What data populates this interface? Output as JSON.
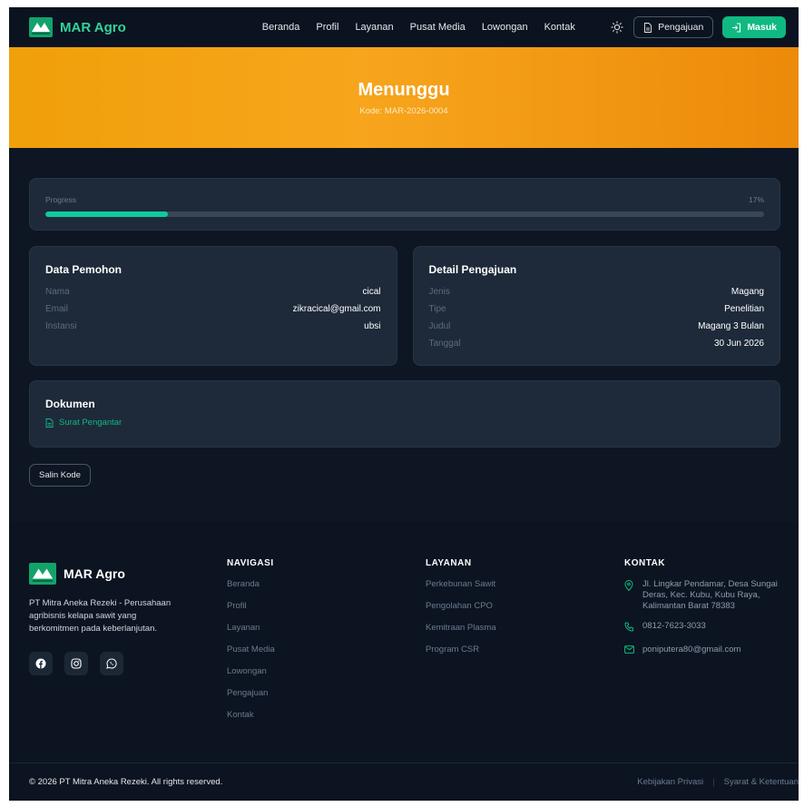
{
  "header": {
    "brand": "MAR Agro",
    "nav": [
      "Beranda",
      "Profil",
      "Layanan",
      "Pusat Media",
      "Lowongan",
      "Kontak"
    ],
    "submit_label": "Pengajuan",
    "login_label": "Masuk"
  },
  "hero": {
    "status": "Menunggu",
    "code": "Kode: MAR-2026-0004"
  },
  "progress": {
    "label": "Progress",
    "percent_text": "17%",
    "value": 0.17
  },
  "applicant": {
    "title": "Data Pemohon",
    "rows": [
      {
        "key": "Nama",
        "value": "cical"
      },
      {
        "key": "Email",
        "value": "zikracical@gmail.com"
      },
      {
        "key": "Instansi",
        "value": "ubsi"
      }
    ]
  },
  "submission": {
    "title": "Detail Pengajuan",
    "rows": [
      {
        "key": "Jenis",
        "value": "Magang"
      },
      {
        "key": "Tipe",
        "value": "Penelitian"
      },
      {
        "key": "Judul",
        "value": "Magang 3 Bulan"
      },
      {
        "key": "Tanggal",
        "value": "30 Jun 2026"
      }
    ]
  },
  "documents": {
    "title": "Dokumen",
    "items": [
      "Surat Pengantar"
    ]
  },
  "copy_label": "Salin Kode",
  "footer": {
    "brand": "MAR Agro",
    "description": "PT Mitra Aneka Rezeki - Perusahaan agribisnis kelapa sawit yang berkomitmen pada keberlanjutan.",
    "nav_title": "NAVIGASI",
    "nav_links": [
      "Beranda",
      "Profil",
      "Layanan",
      "Pusat Media",
      "Lowongan",
      "Pengajuan",
      "Kontak"
    ],
    "services_title": "LAYANAN",
    "services_links": [
      "Perkebunan Sawit",
      "Pengolahan CPO",
      "Kemitraan Plasma",
      "Program CSR"
    ],
    "contact_title": "KONTAK",
    "address": "Jl. Lingkar Pendamar, Desa Sungai Deras, Kec. Kubu, Kubu Raya, Kalimantan Barat 78383",
    "phone": "0812-7623-3033",
    "email": "poniputera80@gmail.com",
    "copyright": "© 2026 PT Mitra Aneka Rezeki. All rights reserved.",
    "privacy": "Kebijakan Privasi",
    "terms": "Syarat & Ketentuan"
  },
  "colors": {
    "accent": "#10b981",
    "hero_start": "#f0a00a",
    "hero_end": "#ec8a0a",
    "background": "#0e1623",
    "card": "#1e2a3a"
  }
}
